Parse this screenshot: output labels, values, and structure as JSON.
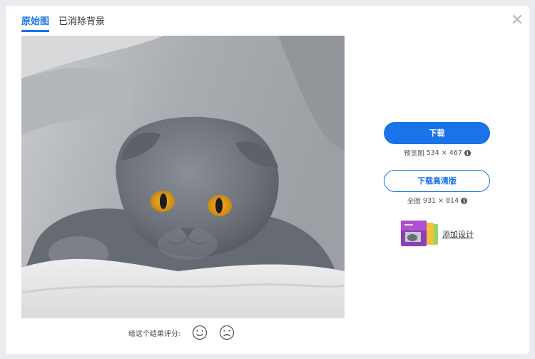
{
  "tabs": [
    {
      "label": "原始图",
      "active": true
    },
    {
      "label": "已消除背景",
      "active": false
    }
  ],
  "actions": {
    "download_label": "下载",
    "preview_label": "预览图",
    "preview_size": "534 × 467",
    "download_hd_label": "下载高清版",
    "full_label": "全图",
    "full_size": "931 × 814",
    "add_design_label": "添加设计"
  },
  "rating": {
    "label": "给这个结果评分:"
  },
  "colors": {
    "accent": "#1a73e8"
  },
  "icons": {
    "close": "close-icon",
    "info": "info-icon",
    "happy": "smile-icon",
    "sad": "frown-icon"
  }
}
